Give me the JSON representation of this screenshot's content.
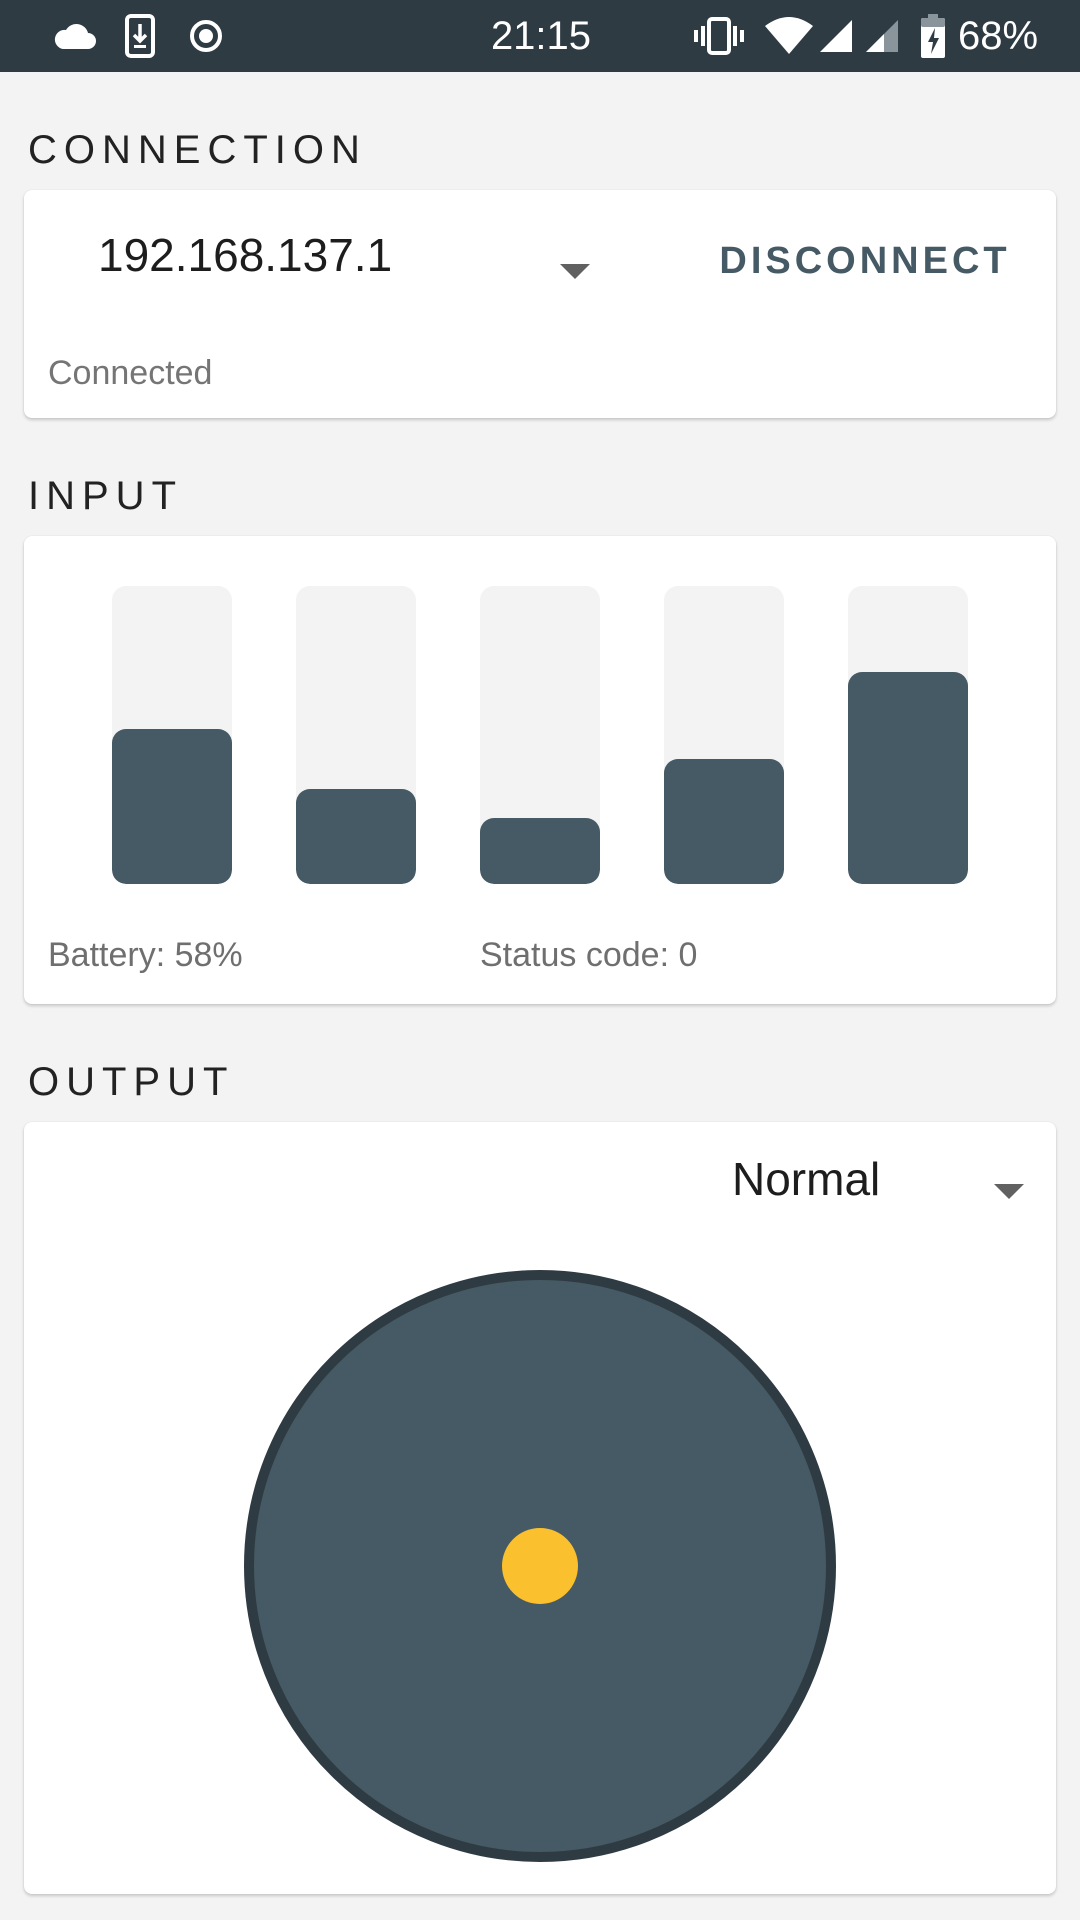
{
  "status_bar": {
    "time": "21:15",
    "battery_percent": "68%",
    "icons": [
      "cloud-icon",
      "download-icon",
      "record-icon",
      "vibrate-icon",
      "wifi-icon",
      "signal-icon",
      "signal-weak-icon",
      "battery-charging-icon"
    ]
  },
  "connection": {
    "section_title": "CONNECTION",
    "ip_address": "192.168.137.1",
    "disconnect_label": "DISCONNECT",
    "status": "Connected"
  },
  "input": {
    "section_title": "INPUT",
    "bar_levels": [
      0.52,
      0.32,
      0.22,
      0.42,
      0.71
    ],
    "battery_text": "Battery: 58%",
    "status_code_text": "Status code: 0"
  },
  "output": {
    "section_title": "OUTPUT",
    "mode": "Normal",
    "knob_offset": [
      0,
      0
    ]
  },
  "colors": {
    "accent": "#455a64",
    "status_bar": "#2f3b43",
    "knob": "#fbc02d",
    "background": "#f3f3f3"
  }
}
